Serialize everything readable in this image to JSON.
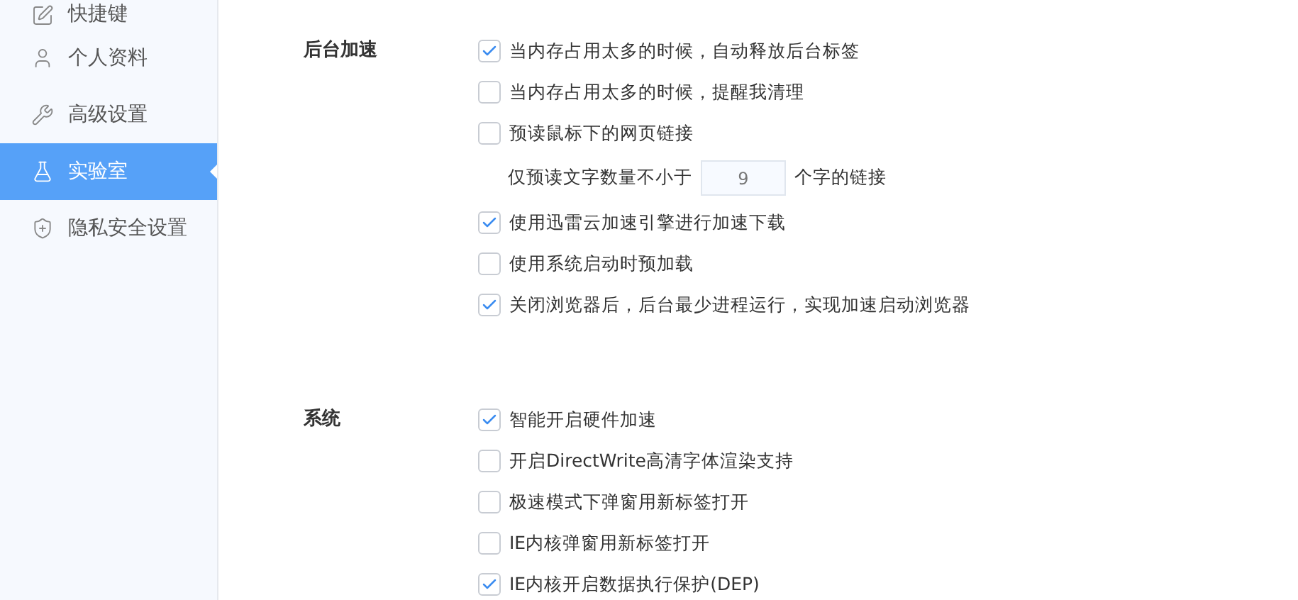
{
  "sidebar": {
    "items": [
      {
        "label": "快捷键",
        "kind": "shortcut",
        "selected": false
      },
      {
        "label": "个人资料",
        "kind": "profile",
        "selected": false
      },
      {
        "label": "高级设置",
        "kind": "advanced",
        "selected": false
      },
      {
        "label": "实验室",
        "kind": "lab",
        "selected": true
      },
      {
        "label": "隐私安全设置",
        "kind": "privacy",
        "selected": false
      }
    ]
  },
  "sections": [
    {
      "label": "后台加速",
      "options": [
        {
          "kind": "checkbox",
          "label": "当内存占用太多的时候，自动释放后台标签",
          "checked": true
        },
        {
          "kind": "checkbox",
          "label": "当内存占用太多的时候，提醒我清理",
          "checked": false
        },
        {
          "kind": "checkbox",
          "label": "预读鼠标下的网页链接",
          "checked": false
        },
        {
          "kind": "number",
          "label_before": "仅预读文字数量不小于",
          "value": "9",
          "label_after": "个字的链接"
        },
        {
          "kind": "checkbox",
          "label": "使用迅雷云加速引擎进行加速下载",
          "checked": true
        },
        {
          "kind": "checkbox",
          "label": "使用系统启动时预加载",
          "checked": false
        },
        {
          "kind": "checkbox",
          "label": "关闭浏览器后，后台最少进程运行，实现加速启动浏览器",
          "checked": true
        }
      ]
    },
    {
      "label": "系统",
      "options": [
        {
          "kind": "checkbox",
          "label": "智能开启硬件加速",
          "checked": true
        },
        {
          "kind": "checkbox",
          "label": "开启DirectWrite高清字体渲染支持",
          "checked": false
        },
        {
          "kind": "checkbox",
          "label": "极速模式下弹窗用新标签打开",
          "checked": false
        },
        {
          "kind": "checkbox",
          "label": "IE内核弹窗用新标签打开",
          "checked": false
        },
        {
          "kind": "checkbox",
          "label": "IE内核开启数据执行保护(DEP)",
          "checked": true
        }
      ]
    }
  ]
}
